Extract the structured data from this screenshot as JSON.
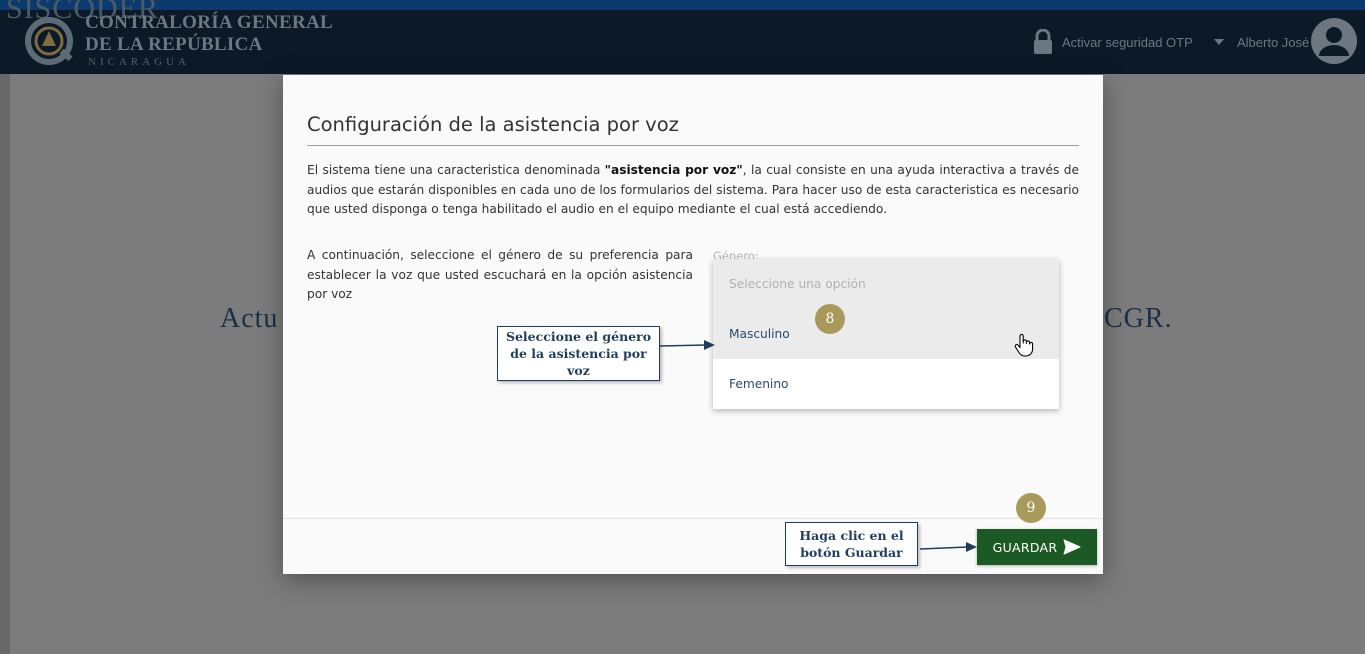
{
  "app": {
    "ghost_title": "SISCODER",
    "logo_lines": [
      "CONTRALORÍA GENERAL",
      "DE LA REPÚBLICA",
      "NICARAGUA"
    ]
  },
  "header": {
    "otp_label": "Activar seguridad OTP",
    "user_name": "Alberto José"
  },
  "background": {
    "heading_left": "Actu",
    "heading_right": "CGR."
  },
  "modal": {
    "title": "Configuración de la asistencia por voz",
    "intro_before": "El sistema tiene una caracteristica denominada ",
    "intro_bold": "\"asistencia por voz\"",
    "intro_after": ", la cual consiste en una ayuda interactiva a través de audios que estarán disponibles en cada uno de los formularios del sistema. Para hacer uso de esta caracteristica es necesario que usted disponga o tenga habilitado el audio en el equipo mediante el cual está accediendo.",
    "instruction": "A continuación, seleccione el género de su preferencia para establecer la voz que usted escuchará en la opción asistencia por voz",
    "gender_label": "Género:",
    "dropdown": {
      "placeholder": "Seleccione una opción",
      "options": [
        "Masculino",
        "Femenino"
      ],
      "hovered": "Masculino"
    },
    "save_label": "GUARDAR"
  },
  "tutorial": {
    "callout_gender": "Seleccione el género de la asistencia por voz",
    "callout_save": "Haga clic en el botón Guardar",
    "step_gender": "8",
    "step_save": "9"
  },
  "colors": {
    "header_bg": "#0c1a28",
    "overlay": "#7c7c7c",
    "save_button": "#1c5a25",
    "step_badge": "#a99a5b",
    "callout_text": "#1f3d5c"
  },
  "icons": [
    "logo-mark-icon",
    "lock-icon",
    "caret-down-icon",
    "user-avatar-icon",
    "hand-cursor-icon",
    "send-icon"
  ]
}
